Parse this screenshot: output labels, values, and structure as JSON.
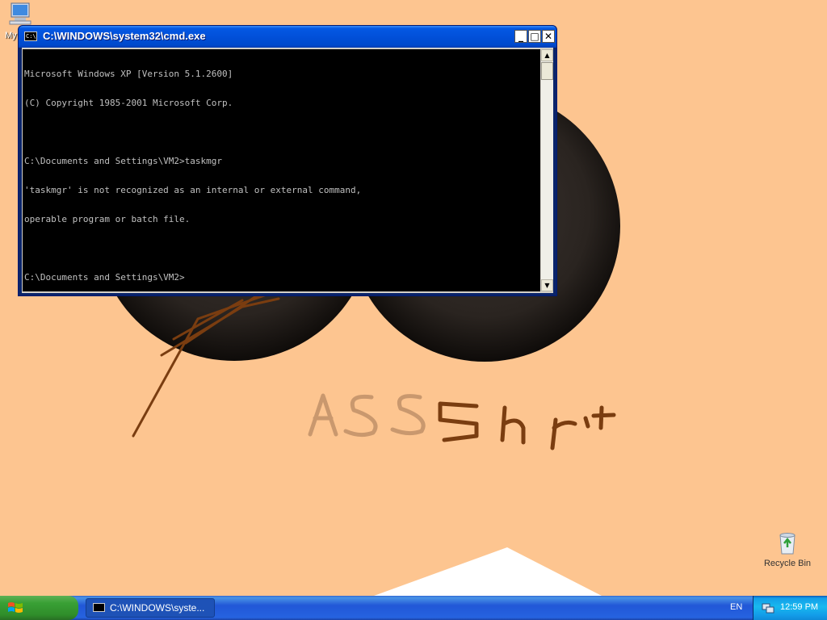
{
  "desktop": {
    "background_color": "#fdc590",
    "icons": [
      {
        "name": "My Computer",
        "label": "My"
      },
      {
        "name": "Recycle Bin",
        "label": "Recycle Bin"
      }
    ],
    "wallpaper_text": "ASSShrt"
  },
  "cmd_window": {
    "title": "C:\\WINDOWS\\system32\\cmd.exe",
    "icon_glyph": "C:\\",
    "buttons": {
      "minimize": "_",
      "maximize": "□",
      "close": "✕"
    },
    "console_lines": [
      "Microsoft Windows XP [Version 5.1.2600]",
      "(C) Copyright 1985-2001 Microsoft Corp.",
      "",
      "C:\\Documents and Settings\\VM2>taskmgr",
      "'taskmgr' is not recognized as an internal or external command,",
      "operable program or batch file.",
      "",
      "C:\\Documents and Settings\\VM2>"
    ],
    "console_bg": "#000000",
    "console_fg": "#c0c0c0"
  },
  "taskbar": {
    "start_label": "",
    "tasks": [
      {
        "label": "C:\\WINDOWS\\syste..."
      }
    ],
    "language": "EN",
    "clock": "12:59 PM"
  }
}
